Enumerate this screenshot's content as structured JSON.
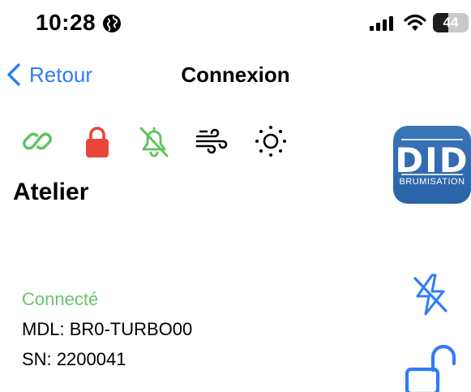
{
  "status_bar": {
    "time": "10:28",
    "battery_level": "44",
    "battery_fraction": 0.44
  },
  "nav": {
    "back_label": "Retour",
    "title": "Connexion"
  },
  "status_icons": [
    {
      "name": "link-icon",
      "color": "#5cc45c"
    },
    {
      "name": "lock-icon",
      "color": "#e9463b"
    },
    {
      "name": "bell-slash-icon",
      "color": "#5cc45c"
    },
    {
      "name": "wind-icon",
      "color": "#000000"
    },
    {
      "name": "sun-icon",
      "color": "#000000"
    }
  ],
  "logo": {
    "title": "DID",
    "subtitle": "BRUMISATION"
  },
  "device": {
    "name": "Atelier",
    "connection_status": "Connecté",
    "model_label": "MDL:",
    "model_value": "BR0-TURBO00",
    "serial_label": "SN:",
    "serial_value": "2200041"
  },
  "colors": {
    "accent_blue": "#2f7cf6",
    "connected_green": "#6cc46c",
    "lock_red": "#e9463b",
    "logo_blue": "#2f68ad"
  }
}
